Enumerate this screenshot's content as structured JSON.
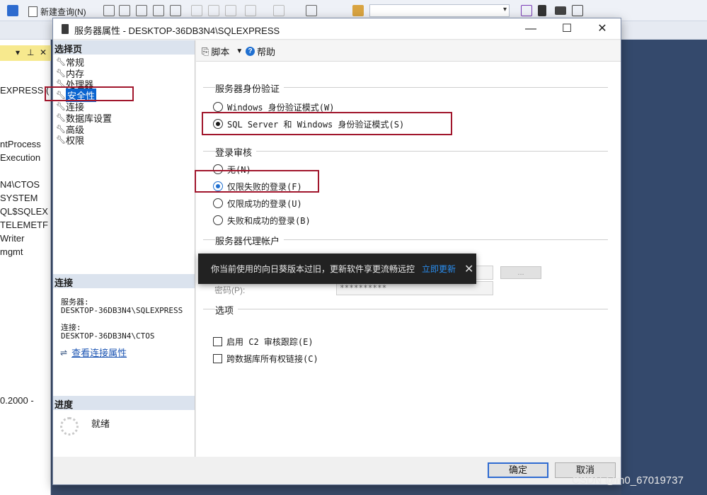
{
  "background_app": {
    "toolbar": {
      "new_query_label": "新建查询(N)"
    },
    "object_explorer": {
      "lines": [
        "EXPRESS (",
        "ntProcess",
        "Execution",
        "N4\\CTOS",
        "SYSTEM",
        "QL$SQLEX",
        "TELEMETF",
        "Writer",
        "mgmt",
        "0.2000 -"
      ]
    }
  },
  "dialog": {
    "title": "服务器属性 - DESKTOP-36DB3N4\\SQLEXPRESS",
    "window_buttons": {
      "minimize": "—",
      "maximize": "☐",
      "close": "✕"
    },
    "left_pane": {
      "select_page_header": "选择页",
      "pages": [
        {
          "label": "常规",
          "selected": false
        },
        {
          "label": "内存",
          "selected": false
        },
        {
          "label": "处理器",
          "selected": false
        },
        {
          "label": "安全性",
          "selected": true
        },
        {
          "label": "连接",
          "selected": false
        },
        {
          "label": "数据库设置",
          "selected": false
        },
        {
          "label": "高级",
          "selected": false
        },
        {
          "label": "权限",
          "selected": false
        }
      ],
      "connection_header": "连接",
      "server_label": "服务器:",
      "server_value": "DESKTOP-36DB3N4\\SQLEXPRESS",
      "connection_label": "连接:",
      "connection_value": "DESKTOP-36DB3N4\\CTOS",
      "view_connection_properties": "查看连接属性",
      "progress_header": "进度",
      "progress_status": "就绪"
    },
    "right_pane": {
      "toolbar": {
        "script_label": "脚本",
        "help_label": "帮助"
      },
      "server_auth": {
        "title": "服务器身份验证",
        "options": [
          {
            "label": "Windows 身份验证模式(W)",
            "checked": false
          },
          {
            "label": "SQL Server 和 Windows 身份验证模式(S)",
            "checked": true
          }
        ]
      },
      "login_audit": {
        "title": "登录审核",
        "options": [
          {
            "label": "无(N)",
            "checked": false
          },
          {
            "label": "仅限失败的登录(F)",
            "checked": true
          },
          {
            "label": "仅限成功的登录(U)",
            "checked": false
          },
          {
            "label": "失败和成功的登录(B)",
            "checked": false
          }
        ]
      },
      "proxy_account": {
        "title": "服务器代理帐户",
        "password_label": "密码(P):",
        "password_value": "**********",
        "browse_label": "..."
      },
      "options": {
        "title": "选项",
        "checkboxes": [
          {
            "label": "启用 C2 审核跟踪(E)",
            "checked": false
          },
          {
            "label": "跨数据库所有权链接(C)",
            "checked": false
          }
        ]
      }
    },
    "buttons": {
      "ok": "确定",
      "cancel": "取消"
    }
  },
  "toast": {
    "message": "你当前使用的向日葵版本过旧，更新软件享更流畅远控",
    "link": "立即更新",
    "close": "✕"
  },
  "watermark": "CSDN @m0_67019737"
}
